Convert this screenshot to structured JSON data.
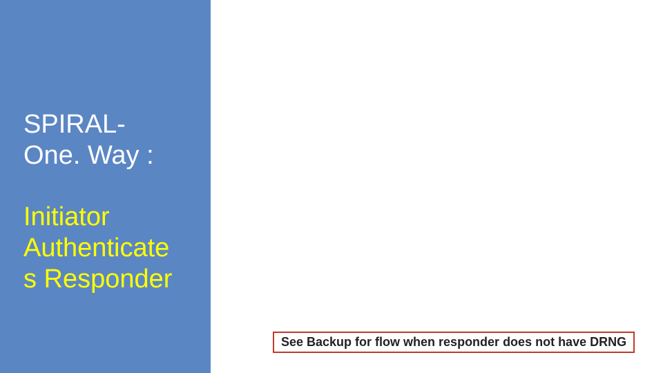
{
  "title": {
    "part1": "SPIRAL-\nOne. Way :",
    "part2": "Initiator\nAuthenticate\ns Responder"
  },
  "note": "See Backup for flow when responder does not have DRNG"
}
